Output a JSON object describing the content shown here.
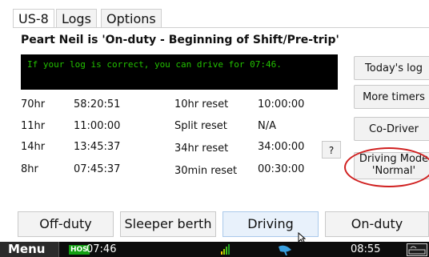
{
  "tabs": [
    {
      "label": "US-8"
    },
    {
      "label": "Logs"
    },
    {
      "label": "Options"
    }
  ],
  "status_line": "Peart Neil is 'On-duty - Beginning of Shift/Pre-trip'",
  "message": "If your log is correct, you can drive for 07:46.",
  "timers": {
    "left": [
      {
        "label": "70hr",
        "value": "58:20:51"
      },
      {
        "label": "11hr",
        "value": "11:00:00"
      },
      {
        "label": "14hr",
        "value": "13:45:37"
      },
      {
        "label": "8hr",
        "value": "07:45:37"
      }
    ],
    "right": [
      {
        "label": "10hr reset",
        "value": "10:00:00"
      },
      {
        "label": "Split reset",
        "value": "N/A"
      },
      {
        "label": "34hr reset",
        "value": "34:00:00"
      },
      {
        "label": "30min reset",
        "value": "00:30:00"
      }
    ]
  },
  "help_button": "?",
  "side_buttons": {
    "todays_log": "Today's log",
    "more_timers": "More timers",
    "co_driver": "Co-Driver",
    "driving_mode_line1": "Driving Mode",
    "driving_mode_line2": "'Normal'"
  },
  "status_buttons": [
    "Off-duty",
    "Sleeper berth",
    "Driving",
    "On-duty"
  ],
  "taskbar": {
    "menu": "Menu",
    "hos_badge": "HOS",
    "hos_time": "07:46",
    "clock": "08:55"
  },
  "colors": {
    "message_bg": "#000000",
    "message_text": "#22c000",
    "highlight": "#d02020",
    "hos_badge": "#12a012"
  },
  "icons": [
    "signal-icon",
    "satellite-dish-icon",
    "cursor-icon",
    "keyboard-icon"
  ]
}
